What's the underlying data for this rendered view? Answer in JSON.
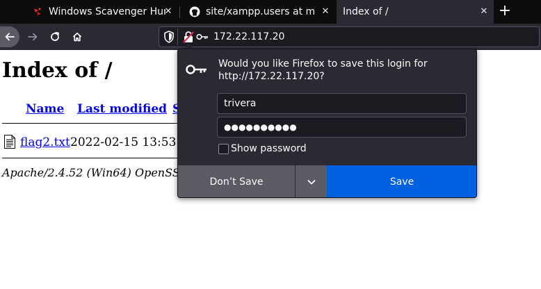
{
  "tabs": [
    {
      "title": "Windows Scavenger Hunt",
      "favicon": "ctf-flag-icon"
    },
    {
      "title": "site/xampp.users at main",
      "favicon": "github-icon"
    },
    {
      "title": "Index of /",
      "favicon": "",
      "active": true
    }
  ],
  "toolbar": {
    "url": "172.22.117.20"
  },
  "page": {
    "title": "Index of /",
    "columns": [
      "Name",
      "Last modified",
      "S"
    ],
    "file": {
      "name": "flag2.txt",
      "modified": "2022-02-15 13:53"
    },
    "footer": "Apache/2.4.52 (Win64) OpenSS"
  },
  "popup": {
    "message": "Would you like Firefox to save this login for http://172.22.117.20?",
    "username": "trivera",
    "password_masked": "●●●●●●●●●●",
    "show_password_label": "Show password",
    "dont_save_label": "Don’t Save",
    "save_label": "Save"
  },
  "colors": {
    "tabstrip": "#0c0c0d",
    "toolbar": "#2b2a33",
    "link": "#0000ee",
    "save_button": "#0061e0",
    "secondary_button": "#5b5b66"
  }
}
